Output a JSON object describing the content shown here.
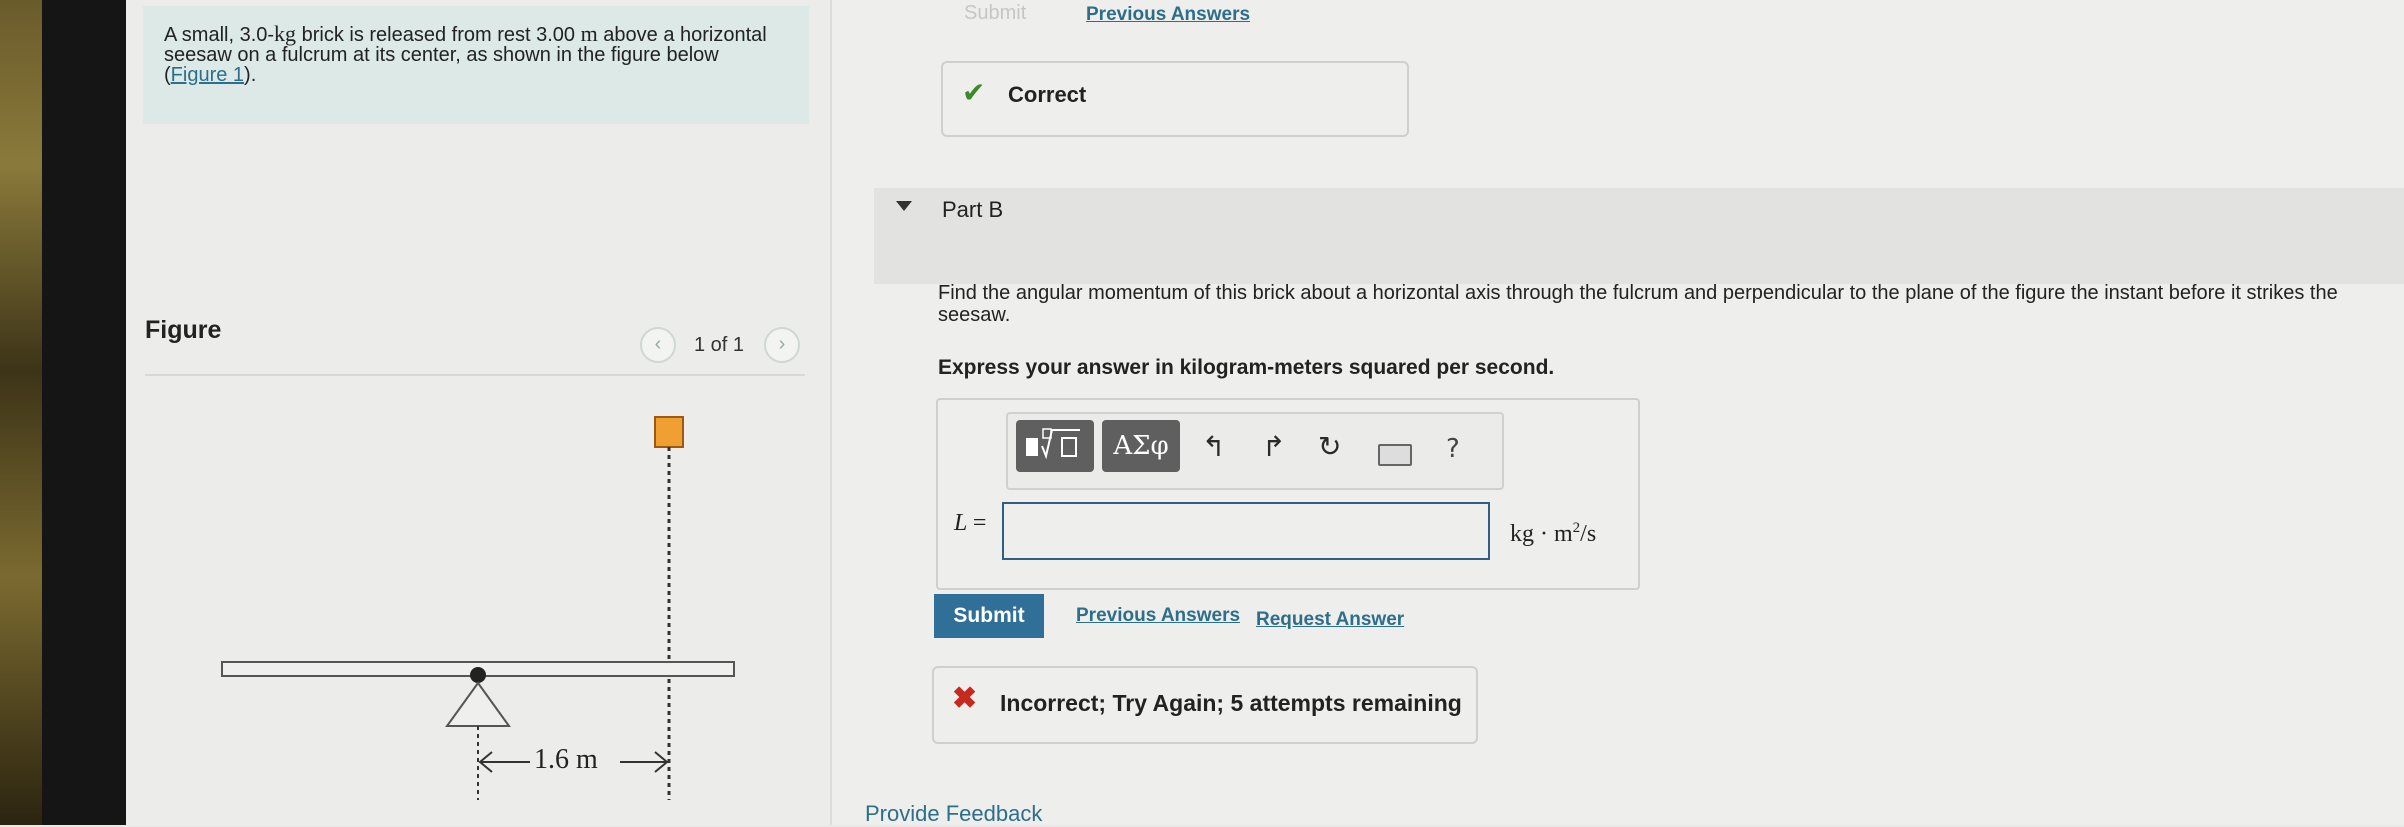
{
  "problem": {
    "text_before": "A small, 3.0-",
    "mass_unit": "kg",
    "text_mid": " brick is released from rest 3.00 ",
    "height_unit": "m",
    "text_after": " above a horizontal seesaw on a fulcrum at its center, as shown in the figure below (",
    "figure_link": "Figure 1",
    "text_end": ")."
  },
  "figure": {
    "title": "Figure",
    "pager": "1 of 1",
    "prev_icon": "chevron-left-icon",
    "next_icon": "chevron-right-icon",
    "distance_label": "1.6 m",
    "brick_color": "#f0a030"
  },
  "part_a": {
    "submit_label": "Submit",
    "previous_answers_label": "Previous Answers",
    "status": "Correct",
    "status_color": "#3b8a2a"
  },
  "part_b": {
    "label": "Part B",
    "question": "Find the angular momentum of this brick about a horizontal axis through the fulcrum and perpendicular to the plane of the figure the instant before it strikes the seesaw.",
    "instruction": "Express your answer in kilogram-meters squared per second.",
    "toolbar": {
      "templates_icon": "templates-icon",
      "symbols_label": "ΑΣφ",
      "undo_icon": "undo-icon",
      "redo_icon": "redo-icon",
      "reset_icon": "reset-icon",
      "keyboard_icon": "keyboard-icon",
      "help_label": "?"
    },
    "variable": "L",
    "equals": "=",
    "answer_value": "",
    "units_base": "kg · m",
    "units_exp": "2",
    "units_tail": "/s",
    "submit_label": "Submit",
    "previous_answers_label": "Previous Answers",
    "request_answer_label": "Request Answer",
    "feedback": "Incorrect; Try Again; 5 attempts remaining",
    "feedback_color": "#c62a1f"
  },
  "footer": {
    "provide_feedback": "Provide Feedback"
  },
  "colors": {
    "accent": "#2f6f98",
    "link": "#2d6f8a",
    "problem_bg": "#dce9e7"
  }
}
